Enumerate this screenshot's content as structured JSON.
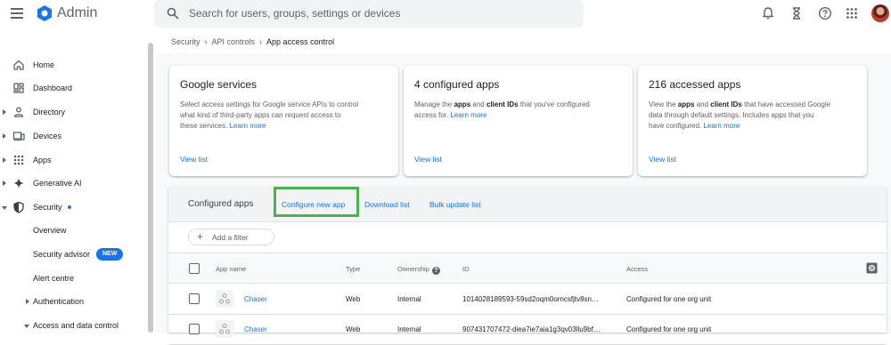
{
  "header": {
    "app_title": "Admin",
    "search_placeholder": "Search for users, groups, settings or devices",
    "brand_color": "#1a73e8"
  },
  "sidebar": {
    "items": [
      {
        "label": "Home",
        "icon": "home-icon"
      },
      {
        "label": "Dashboard",
        "icon": "dashboard-icon"
      },
      {
        "label": "Directory",
        "icon": "person-icon"
      },
      {
        "label": "Devices",
        "icon": "devices-icon"
      },
      {
        "label": "Apps",
        "icon": "apps-grid-icon"
      },
      {
        "label": "Generative AI",
        "icon": "sparkle-icon"
      },
      {
        "label": "Security",
        "icon": "shield-icon"
      },
      {
        "label": "Overview"
      },
      {
        "label": "Security advisor",
        "badge": "NEW"
      },
      {
        "label": "Alert centre"
      },
      {
        "label": "Authentication"
      },
      {
        "label": "Access and data control"
      }
    ]
  },
  "breadcrumb": {
    "items": [
      "Security",
      "API controls"
    ],
    "current": "App access control"
  },
  "cards": [
    {
      "title": "Google services",
      "desc_1": "Select access settings for Google service APIs to control",
      "desc_2": "what kind of third-party apps can request access to",
      "desc_3": "these services.",
      "learn_more": "Learn more",
      "link": "View list"
    },
    {
      "title": "4 configured apps",
      "desc_a": "Manage the",
      "desc_b1": "apps",
      "desc_c": "and",
      "desc_b2": "client IDs",
      "desc_d": "that you've configured",
      "desc_2": "access for.",
      "learn_more": "Learn more",
      "link": "View list"
    },
    {
      "title": "216 accessed apps",
      "desc_a": "View the",
      "desc_b1": "apps",
      "desc_c": "and",
      "desc_b2": "client IDs",
      "desc_d": "that have accessed Google",
      "desc_2": "data through default settings. Includes apps that you",
      "desc_3": "have configured.",
      "learn_more": "Learn more",
      "link": "View list"
    }
  ],
  "configured": {
    "title": "Configured apps",
    "actions": [
      "Configure new app",
      "Download list",
      "Bulk update list"
    ],
    "filter_label": "Add a filter",
    "columns": [
      "App name",
      "Type",
      "Ownership",
      "ID",
      "Access"
    ],
    "rows": [
      {
        "name": "Chaser",
        "type": "Web",
        "ownership": "Internal",
        "id": "1014028189593-59sd2oqm0orncsfjtv8sn…",
        "access": "Configured for one org unit"
      },
      {
        "name": "Chaser",
        "type": "Web",
        "ownership": "Internal",
        "id": "907431707472-diea7ie7aia1g3qv03llu9bf…",
        "access": "Configured for one org unit"
      }
    ]
  }
}
